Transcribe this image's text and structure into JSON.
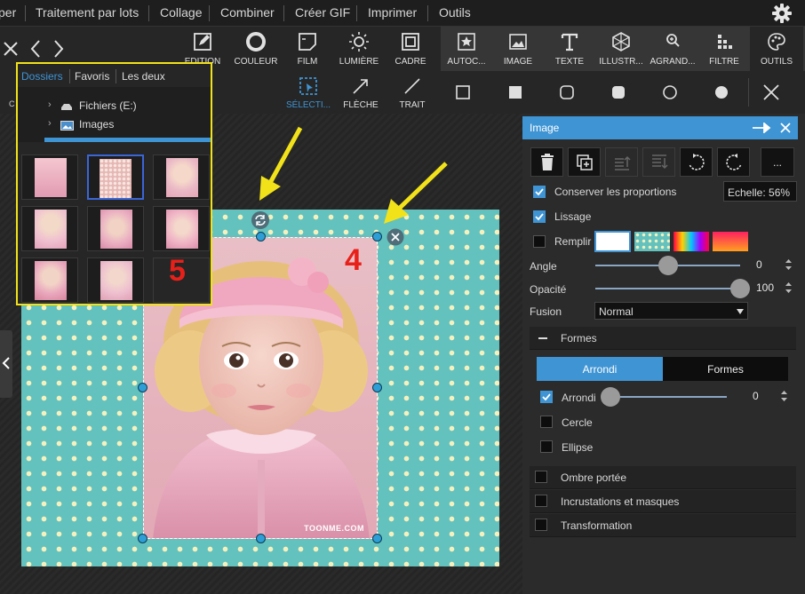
{
  "menu": [
    "per",
    "Traitement par lots",
    "Collage",
    "Combiner",
    "Créer GIF",
    "Imprimer",
    "Outils"
  ],
  "toolbar": {
    "left_tools": [
      "EDITION",
      "COULEUR",
      "FILM",
      "LUMIÈRE",
      "CADRE"
    ],
    "right_tools": [
      "AUTOC...",
      "IMAGE",
      "TEXTE",
      "ILLUSTR...",
      "AGRAND...",
      "FILTRE",
      "OUTILS"
    ]
  },
  "toolbar2": {
    "left_stub": "C",
    "tools": [
      "SÉLECTI...",
      "FLÈCHE",
      "TRAIT"
    ]
  },
  "browser": {
    "tabs": [
      "Dossiers",
      "Favoris",
      "Les deux"
    ],
    "tree": [
      "Fichiers (E:)",
      "Images"
    ],
    "overlay_number": "5"
  },
  "canvas": {
    "overlay_number": "4",
    "watermark": "TOONME.COM"
  },
  "panel": {
    "title": "Image",
    "more_label": "...",
    "keep_proportions": "Conserver les proportions",
    "scale": "Echelle: 56%",
    "smoothing": "Lissage",
    "fill": "Remplir",
    "angle_label": "Angle",
    "angle_value": "0",
    "angle_fraction": 0.5,
    "opacity_label": "Opacité",
    "opacity_value": "100",
    "opacity_fraction": 1.0,
    "blend_label": "Fusion",
    "blend_value": "Normal",
    "shapes_section": "Formes",
    "tab_rounded": "Arrondi",
    "tab_shapes": "Formes",
    "rounded_label": "Arrondi",
    "rounded_value": "0",
    "circle_label": "Cercle",
    "ellipse_label": "Ellipse",
    "shadow_section": "Ombre portée",
    "inlays_section": "Incrustations et masques",
    "transform_section": "Transformation"
  },
  "colors": {
    "accent": "#3f94d4",
    "artboard": "#63c2bd",
    "dots": "#f4f0c0",
    "overlay_number": "#e8201a",
    "highlight": "#f2e21a"
  }
}
